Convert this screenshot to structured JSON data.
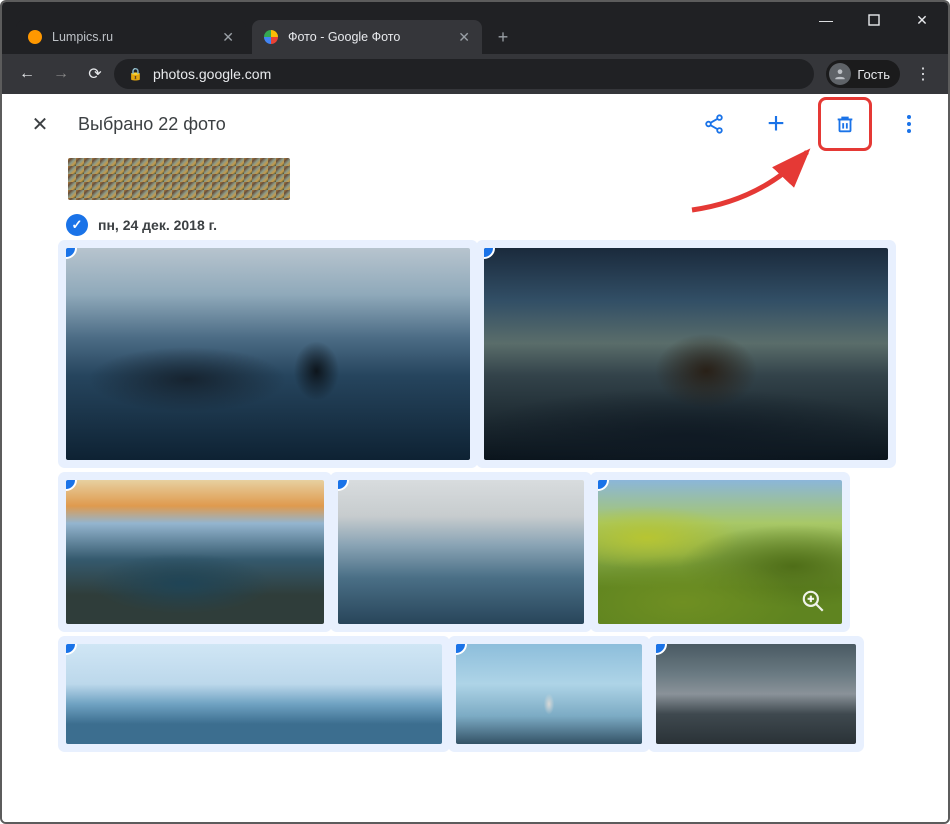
{
  "window": {
    "minimize": "—",
    "maximize": "□",
    "close": "✕"
  },
  "tabs": [
    {
      "title": "Lumpics.ru",
      "active": false
    },
    {
      "title": "Фото - Google Фото",
      "active": true
    }
  ],
  "address_bar": {
    "url": "photos.google.com"
  },
  "profile": {
    "label": "Гость"
  },
  "appbar": {
    "selection_text": "Выбрано 22 фото"
  },
  "section": {
    "date_label": "пн, 24 дек. 2018 г."
  },
  "icons": {
    "check": "✓",
    "close_tab": "✕",
    "new_tab": "+",
    "nav_back": "←",
    "nav_fwd": "→",
    "reload": "⟳",
    "lock": "🔒",
    "kebab": "⋮",
    "app_close": "✕",
    "plus": "+"
  }
}
